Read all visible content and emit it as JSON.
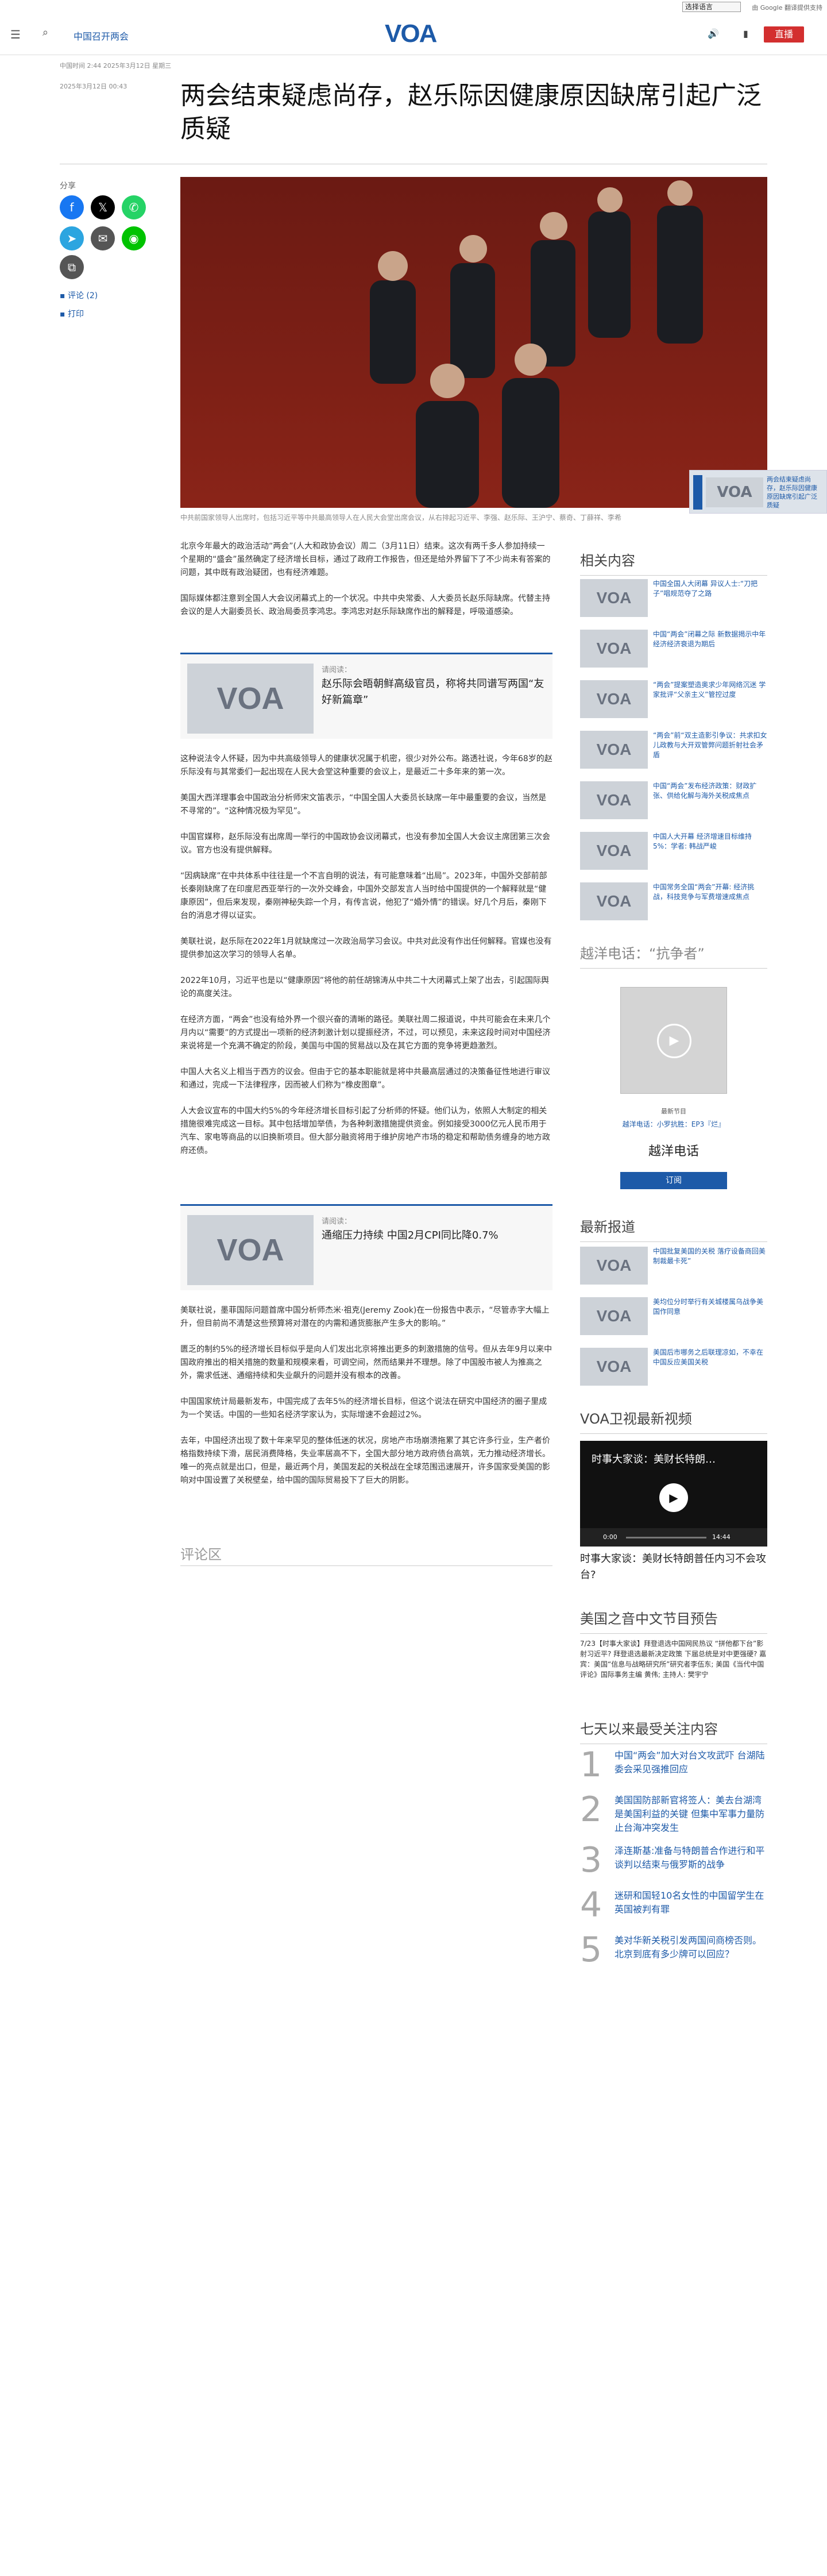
{
  "topbar": {
    "language_select": "选择语言",
    "google_translate": "由 Google 翻译提供支持"
  },
  "header": {
    "section_label": "中国召开两会",
    "logo": "VOA",
    "live_label": "直播"
  },
  "article": {
    "meta_updated": "中国时间 2:44 2025年3月12日 星期三",
    "meta_published": "2025年3月12日 00:43",
    "title": "两会结束疑虑尚存，赵乐际因健康原因缺席引起广泛质疑",
    "share_label": "分享",
    "comment_link": "评论 (2)",
    "print_link": "打印",
    "caption": "中共前国家领导人出席时，包括习近平等中共最高领导人在人民大会堂出席会议，从右排起习近平、李强、赵乐际、王沪宁、蔡奇、丁薛祥、李希",
    "paragraphs": [
      "北京今年最大的政治活动“两会”(人大和政协会议）周二（3月11日）结束。这次有两千多人参加持续一个星期的“盛会”虽然确定了经济增长目标，通过了政府工作报告，但还是给外界留下了不少尚未有答案的问题，其中既有政治疑团，也有经济难题。",
      "国际媒体都注意到全国人大会议闭幕式上的一个状况。中共中央常委、人大委员长赵乐际缺席。代替主持会议的是人大副委员长、政治局委员李鸿忠。李鸿忠对赵乐际缺席作出的解释是，呼吸道感染。"
    ],
    "related1": {
      "tag": "请阅读：",
      "title": "赵乐际会晤朝鲜高级官员，称将共同谱写两国“友好新篇章”"
    },
    "paragraphs2": [
      "这种说法令人怀疑，因为中共高级领导人的健康状况属于机密，很少对外公布。路透社说，今年68岁的赵乐际没有与其常委们一起出现在人民大会堂这种重要的会议上，是最近二十多年来的第一次。",
      "美国大西洋理事会中国政治分析师宋文笛表示，“中国全国人大委员长缺席一年中最重要的会议，当然是不寻常的”。“这种情况极为罕见”。",
      "中国官媒称，赵乐际没有出席周一举行的中国政协会议闭幕式，也没有参加全国人大会议主席团第三次会议。官方也没有提供解释。",
      "“因病缺席”在中共体系中往往是一个不言自明的说法，有可能意味着“出局”。2023年，中国外交部前部长秦刚缺席了在印度尼西亚举行的一次外交峰会，中国外交部发言人当时给中国提供的一个解释就是“健康原因”，但后来发现，秦刚神秘失踪一个月，有传言说，他犯了“婚外情”的错误。好几个月后，秦刚下台的消息才得以证实。",
      "美联社说，赵乐际在2022年1月就缺席过一次政治局学习会议。中共对此没有作出任何解释。官媒也没有提供参加这次学习的领导人名单。",
      "2022年10月，习近平也是以“健康原因”将他的前任胡锦涛从中共二十大闭幕式上架了出去，引起国际舆论的高度关注。",
      "在经济方面，“两会”也没有给外界一个很兴奋的清晰的路径。美联社周二报道说，中共可能会在未来几个月内以“需要”的方式提出一项新的经济刺激计划以提振经济，不过，可以预见，未来这段时间对中国经济来说将是一个充满不确定的阶段，美国与中国的贸易战以及在其它方面的竞争将更趋激烈。",
      "中国人大名义上相当于西方的议会。但由于它的基本职能就是将中共最高层通过的决策备征性地进行审议和通过，完成一下法律程序，因而被人们称为“橡皮图章”。",
      "人大会议宣布的中国大约5%的今年经济增长目标引起了分析师的怀疑。他们认为，依照人大制定的相关措施很难完成这一目标。其中包括增加举债，为各种刺激措施提供资金。例如接受3000亿元人民币用于汽车、家电等商品的以旧换新项目。但大部分融资将用于维护房地产市场的稳定和帮助债务缠身的地方政府还债。"
    ],
    "related2": {
      "tag": "请阅读：",
      "title": "通缩压力持续 中国2月CPI同比降0.7%"
    },
    "paragraphs3": [
      "美联社说，墨菲国际问题首席中国分析师杰米·祖克(Jeremy Zook)在一份报告中表示，“尽管赤字大幅上升，但目前尚不清楚这些预算将对潜在的内需和通货膨胀产生多大的影响。”",
      "匮乏的制约5%的经济增长目标似乎是向人们发出北京将推出更多的刺激措施的信号。但从去年9月以来中国政府推出的相关措施的数量和规模来看，可调空间，然而结果并不理想。除了中国股市被人为推高之外，需求低迷、通缩持续和失业飙升的问题并没有根本的改善。",
      "中国国家统计局最新发布，中国完成了去年5%的经济增长目标，但这个说法在研究中国经济的圈子里成为一个笑话。中国的一些知名经济学家认为，实际增速不会超过2%。",
      "去年，中国经济出现了数十年来罕见的整体低迷的状况，房地产市场崩溃拖累了其它许多行业，生产者价格指数持续下滑，居民消费降格，失业率居高不下，全国大部分地方政府债台高筑，无力推动经济增长。唯一的亮点就是出口，但是，最近两个月，美国发起的关税战在全球范围迅速展开，许多国家受美国的影响对中国设置了关税壁垒，给中国的国际贸易投下了巨大的阴影。"
    ],
    "comments_heading": "评论区"
  },
  "sidebar": {
    "related_heading": "相关内容",
    "related_items": [
      "中国全国人大闭幕 异议人士:“刀把子”唱规范夺了之路",
      "中国“两会”闭幕之际 新数据揭示中年经济经济衰退为期后",
      "“两会”提案塑造奥求少年网络沉迷 学家批评“父亲主义”管控过度",
      "“两会”前“双主造影引争议：共求扣女儿政教与大开双管弊问题折射社会矛盾",
      "中国“两会”发布经济政策：财政扩张、供给化解与海外关税成焦点",
      "中国人大开幕 经济增速目标维持5%：学者: 韩战严峻",
      "中国常务全国“两会”开幕: 经济挑战，科技竞争与军费增速成焦点"
    ],
    "podcast_heading": "越洋电话：“抗争者”",
    "podcast_tag": "最新节目",
    "podcast_links": "越洋电话：小罗抗胜：EP3『烂』",
    "podcast_title": "越洋电话",
    "subscribe_label": "订阅",
    "latest_heading": "最新报道",
    "latest_items": [
      "中国批复美国的关税 落疗设备商回美制裁最卡死”",
      "美均位分时举行有关城楼属乌战争美国作同意",
      "美国后市哪务之后联理凉如，不幸在中国反应美国关税"
    ],
    "video_heading": "VOA卫视最新视频",
    "video_overlay": "时事大家谈：美财长特朗…",
    "video_time_current": "0:00",
    "video_time_total": "14:44",
    "video_caption": "时事大家谈：美财长特朗普任内习不会攻台?",
    "audio_heading": "美国之音中文节目预告",
    "audio_text": "7/23【时事大家谈】拜登退选中国网民热议 “拼他都下台”影射习近平? 拜登退选最新决定政策 下届总统是对中更强硬? 嘉宾：美国“信息与战略研究所”研究者李伍东; 美国《当代中国评论》国际事务主编 黄伟; 主持人: 樊宇宁",
    "popular_heading": "七天以来最受关注内容",
    "popular_items": [
      "中国“两会”加大对台文攻武吓 台湖陆委会采见强推回应",
      "美国国防部新官将签人：美去台湖湾是美国利益的关键 但集中军事力量防止台海冲突发生",
      "泽连斯基:准备与特朗普合作进行和平谈判以结束与俄罗斯的战争",
      "迷研和国轻10名女性的中国留学生在英国被判有罪",
      "美对华新关税引发两国间商榜否则。北京到底有多少牌可以回应？"
    ]
  },
  "float_box": "两会结束疑虑尚存，赵乐际因健康原因缺席引起广泛质疑",
  "colors": {
    "accent": "#1d5aa8",
    "live": "#d32f2f",
    "facebook": "#1877f2",
    "x": "#000000",
    "whatsapp": "#25d366",
    "telegram": "#2ca5e0",
    "email": "#555555",
    "line": "#00c300"
  },
  "icons": [
    "menu-icon",
    "search-icon",
    "speaker-icon",
    "video-icon",
    "facebook-icon",
    "x-icon",
    "whatsapp-icon",
    "telegram-icon",
    "email-icon",
    "line-icon",
    "copy-link-icon",
    "comment-icon",
    "print-icon",
    "play-icon"
  ]
}
